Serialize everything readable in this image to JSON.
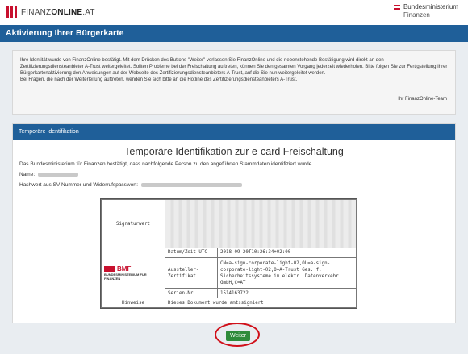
{
  "header": {
    "logo_brand": "FINANZ",
    "logo_brand_bold": "ONLINE",
    "logo_suffix": ".AT",
    "ministry_line1": "Bundesministerium",
    "ministry_line2": "Finanzen"
  },
  "page_title": "Aktivierung Ihrer Bürgerkarte",
  "info": {
    "text1": "Ihre Identität wurde von FinanzOnline bestätigt. Mit dem Drücken des Buttons \"Weiter\" verlassen Sie FinanzOnline und die nebenstehende Bestätigung wird direkt an den Zertifizierungsdiensteanbieter A-Trust weitergeleitet. Sollten Probleme bei der Freischaltung auftreten, können Sie den gesamten Vorgang jederzeit wiederholen. Bitte folgen Sie zur Fertigstellung Ihrer Bürgerkartenaktivierung den Anweisungen auf der Webseite des Zertifizierungsdiensteanbieters A-Trust, auf die Sie nun weitergeleitet werden.",
    "text2": "Bei Fragen, die nach der Weiterleitung auftreten, wenden Sie sich bitte an die Hotline des Zertifizierungsdiensteanbieters A-Trust.",
    "signoff": "Ihr FinanzOnline-Team"
  },
  "panel": {
    "header": "Temporäre Identifikation",
    "title": "Temporäre Identifikation zur e-card Freischaltung",
    "lead": "Das Bundesministerium für Finanzen bestätigt, dass nachfolgende Person zu den angeführten Stammdaten identifiziert wurde.",
    "name_label": "Name:",
    "hash_label": "Hashwert aus SV-Nummer und Widerrufspasswort:"
  },
  "signature": {
    "sig_label": "Signaturwert",
    "date_key": "Datum/Zeit-UTC",
    "date_val": "2018-09-20T10:26:34+02:00",
    "issuer_key": "Aussteller-Zertifikat",
    "issuer_val": "CN=a-sign-corporate-light-02,OU=a-sign-corporate-light-02,O=A-Trust Ges. f. Sicherheitssysteme im elektr. Datenverkehr GmbH,C=AT",
    "serial_key": "Serien-Nr.",
    "serial_val": "1514163722",
    "hint_key": "Hinweise",
    "hint_val": "Dieses Dokument wurde amtssigniert.",
    "logo_word": "BMF",
    "logo_sub": "BUNDESMINISTERIUM FÜR FINANZEN"
  },
  "actions": {
    "next_label": "Weiter"
  }
}
